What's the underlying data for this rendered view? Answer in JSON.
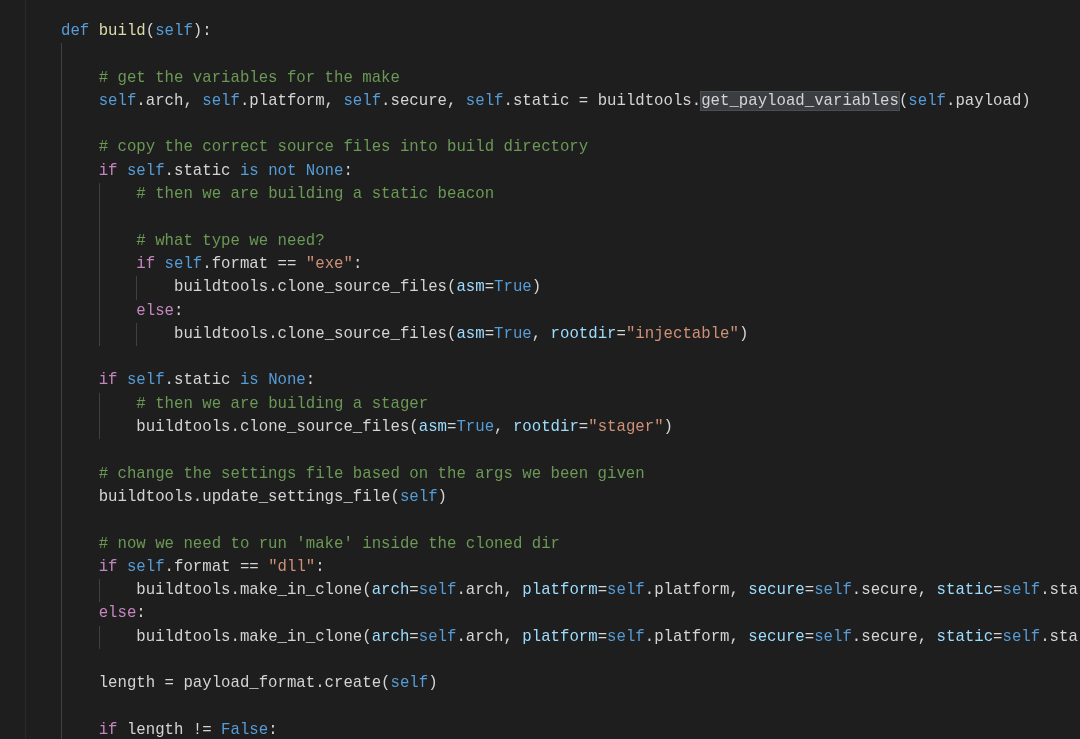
{
  "editor": {
    "lines": [
      {
        "kind": "code",
        "tokens": [
          {
            "kind": "kw",
            "text": "def"
          },
          {
            "kind": "fn",
            "text": " build"
          },
          {
            "kind": "plain",
            "text": "("
          },
          {
            "kind": "self",
            "text": "self"
          },
          {
            "kind": "plain",
            "text": "):"
          }
        ],
        "children": [
          {
            "kind": "blank"
          },
          {
            "kind": "code",
            "tokens": [
              {
                "kind": "comment",
                "text": "# get the variables for the make"
              }
            ]
          },
          {
            "kind": "code",
            "tokens": [
              {
                "kind": "self",
                "text": "self"
              },
              {
                "kind": "plain",
                "text": ".arch, "
              },
              {
                "kind": "self",
                "text": "self"
              },
              {
                "kind": "plain",
                "text": ".platform, "
              },
              {
                "kind": "self",
                "text": "self"
              },
              {
                "kind": "plain",
                "text": ".secure, "
              },
              {
                "kind": "self",
                "text": "self"
              },
              {
                "kind": "plain",
                "text": ".static = buildtools."
              },
              {
                "kind": "hl",
                "text": "get_payload_variables"
              },
              {
                "kind": "plain",
                "text": "("
              },
              {
                "kind": "self",
                "text": "self"
              },
              {
                "kind": "plain",
                "text": ".payload)"
              }
            ]
          },
          {
            "kind": "blank"
          },
          {
            "kind": "code",
            "tokens": [
              {
                "kind": "comment",
                "text": "# copy the correct source files into build directory"
              }
            ]
          },
          {
            "kind": "code",
            "tokens": [
              {
                "kind": "ctrl",
                "text": "if"
              },
              {
                "kind": "self",
                "text": " self"
              },
              {
                "kind": "plain",
                "text": ".static "
              },
              {
                "kind": "kw",
                "text": "is not None"
              },
              {
                "kind": "plain",
                "text": ":"
              }
            ],
            "children": [
              {
                "kind": "code",
                "tokens": [
                  {
                    "kind": "comment",
                    "text": "# then we are building a static beacon"
                  }
                ]
              },
              {
                "kind": "blank"
              },
              {
                "kind": "code",
                "tokens": [
                  {
                    "kind": "comment",
                    "text": "# what type we need?"
                  }
                ]
              },
              {
                "kind": "code",
                "tokens": [
                  {
                    "kind": "ctrl",
                    "text": "if"
                  },
                  {
                    "kind": "self",
                    "text": " self"
                  },
                  {
                    "kind": "plain",
                    "text": ".format == "
                  },
                  {
                    "kind": "str",
                    "text": "\"exe\""
                  },
                  {
                    "kind": "plain",
                    "text": ":"
                  }
                ],
                "children": [
                  {
                    "kind": "code",
                    "tokens": [
                      {
                        "kind": "plain",
                        "text": "buildtools.clone_source_files("
                      },
                      {
                        "kind": "param",
                        "text": "asm"
                      },
                      {
                        "kind": "plain",
                        "text": "="
                      },
                      {
                        "kind": "kw",
                        "text": "True"
                      },
                      {
                        "kind": "plain",
                        "text": ")"
                      }
                    ]
                  }
                ]
              },
              {
                "kind": "code",
                "tokens": [
                  {
                    "kind": "ctrl",
                    "text": "else"
                  },
                  {
                    "kind": "plain",
                    "text": ":"
                  }
                ],
                "children": [
                  {
                    "kind": "code",
                    "tokens": [
                      {
                        "kind": "plain",
                        "text": "buildtools.clone_source_files("
                      },
                      {
                        "kind": "param",
                        "text": "asm"
                      },
                      {
                        "kind": "plain",
                        "text": "="
                      },
                      {
                        "kind": "kw",
                        "text": "True"
                      },
                      {
                        "kind": "plain",
                        "text": ", "
                      },
                      {
                        "kind": "param",
                        "text": "rootdir"
                      },
                      {
                        "kind": "plain",
                        "text": "="
                      },
                      {
                        "kind": "str",
                        "text": "\"injectable\""
                      },
                      {
                        "kind": "plain",
                        "text": ")"
                      }
                    ]
                  }
                ]
              }
            ]
          },
          {
            "kind": "blank"
          },
          {
            "kind": "code",
            "tokens": [
              {
                "kind": "ctrl",
                "text": "if"
              },
              {
                "kind": "self",
                "text": " self"
              },
              {
                "kind": "plain",
                "text": ".static "
              },
              {
                "kind": "kw",
                "text": "is None"
              },
              {
                "kind": "plain",
                "text": ":"
              }
            ],
            "children": [
              {
                "kind": "code",
                "tokens": [
                  {
                    "kind": "comment",
                    "text": "# then we are building a stager"
                  }
                ]
              },
              {
                "kind": "code",
                "tokens": [
                  {
                    "kind": "plain",
                    "text": "buildtools.clone_source_files("
                  },
                  {
                    "kind": "param",
                    "text": "asm"
                  },
                  {
                    "kind": "plain",
                    "text": "="
                  },
                  {
                    "kind": "kw",
                    "text": "True"
                  },
                  {
                    "kind": "plain",
                    "text": ", "
                  },
                  {
                    "kind": "param",
                    "text": "rootdir"
                  },
                  {
                    "kind": "plain",
                    "text": "="
                  },
                  {
                    "kind": "str",
                    "text": "\"stager\""
                  },
                  {
                    "kind": "plain",
                    "text": ")"
                  }
                ]
              }
            ]
          },
          {
            "kind": "blank"
          },
          {
            "kind": "code",
            "tokens": [
              {
                "kind": "comment",
                "text": "# change the settings file based on the args we been given"
              }
            ]
          },
          {
            "kind": "code",
            "tokens": [
              {
                "kind": "plain",
                "text": "buildtools.update_settings_file("
              },
              {
                "kind": "self",
                "text": "self"
              },
              {
                "kind": "plain",
                "text": ")"
              }
            ]
          },
          {
            "kind": "blank"
          },
          {
            "kind": "code",
            "tokens": [
              {
                "kind": "comment",
                "text": "# now we need to run 'make' inside the cloned dir"
              }
            ]
          },
          {
            "kind": "code",
            "tokens": [
              {
                "kind": "ctrl",
                "text": "if"
              },
              {
                "kind": "self",
                "text": " self"
              },
              {
                "kind": "plain",
                "text": ".format == "
              },
              {
                "kind": "str",
                "text": "\"dll\""
              },
              {
                "kind": "plain",
                "text": ":"
              }
            ],
            "children": [
              {
                "kind": "code",
                "tokens": [
                  {
                    "kind": "plain",
                    "text": "buildtools.make_in_clone("
                  },
                  {
                    "kind": "param",
                    "text": "arch"
                  },
                  {
                    "kind": "plain",
                    "text": "="
                  },
                  {
                    "kind": "self",
                    "text": "self"
                  },
                  {
                    "kind": "plain",
                    "text": ".arch, "
                  },
                  {
                    "kind": "param",
                    "text": "platform"
                  },
                  {
                    "kind": "plain",
                    "text": "="
                  },
                  {
                    "kind": "self",
                    "text": "self"
                  },
                  {
                    "kind": "plain",
                    "text": ".platform, "
                  },
                  {
                    "kind": "param",
                    "text": "secure"
                  },
                  {
                    "kind": "plain",
                    "text": "="
                  },
                  {
                    "kind": "self",
                    "text": "self"
                  },
                  {
                    "kind": "plain",
                    "text": ".secure, "
                  },
                  {
                    "kind": "param",
                    "text": "static"
                  },
                  {
                    "kind": "plain",
                    "text": "="
                  },
                  {
                    "kind": "self",
                    "text": "self"
                  },
                  {
                    "kind": "plain",
                    "text": ".sta"
                  }
                ]
              }
            ]
          },
          {
            "kind": "code",
            "tokens": [
              {
                "kind": "ctrl",
                "text": "else"
              },
              {
                "kind": "plain",
                "text": ":"
              }
            ],
            "children": [
              {
                "kind": "code",
                "tokens": [
                  {
                    "kind": "plain",
                    "text": "buildtools.make_in_clone("
                  },
                  {
                    "kind": "param",
                    "text": "arch"
                  },
                  {
                    "kind": "plain",
                    "text": "="
                  },
                  {
                    "kind": "self",
                    "text": "self"
                  },
                  {
                    "kind": "plain",
                    "text": ".arch, "
                  },
                  {
                    "kind": "param",
                    "text": "platform"
                  },
                  {
                    "kind": "plain",
                    "text": "="
                  },
                  {
                    "kind": "self",
                    "text": "self"
                  },
                  {
                    "kind": "plain",
                    "text": ".platform, "
                  },
                  {
                    "kind": "param",
                    "text": "secure"
                  },
                  {
                    "kind": "plain",
                    "text": "="
                  },
                  {
                    "kind": "self",
                    "text": "self"
                  },
                  {
                    "kind": "plain",
                    "text": ".secure, "
                  },
                  {
                    "kind": "param",
                    "text": "static"
                  },
                  {
                    "kind": "plain",
                    "text": "="
                  },
                  {
                    "kind": "self",
                    "text": "self"
                  },
                  {
                    "kind": "plain",
                    "text": ".sta"
                  }
                ]
              }
            ]
          },
          {
            "kind": "blank"
          },
          {
            "kind": "code",
            "tokens": [
              {
                "kind": "plain",
                "text": "length = payload_format.create("
              },
              {
                "kind": "self",
                "text": "self"
              },
              {
                "kind": "plain",
                "text": ")"
              }
            ]
          },
          {
            "kind": "blank"
          },
          {
            "kind": "code",
            "tokens": [
              {
                "kind": "ctrl",
                "text": "if"
              },
              {
                "kind": "plain",
                "text": " length != "
              },
              {
                "kind": "kw",
                "text": "False"
              },
              {
                "kind": "plain",
                "text": ":"
              }
            ]
          }
        ]
      }
    ]
  }
}
